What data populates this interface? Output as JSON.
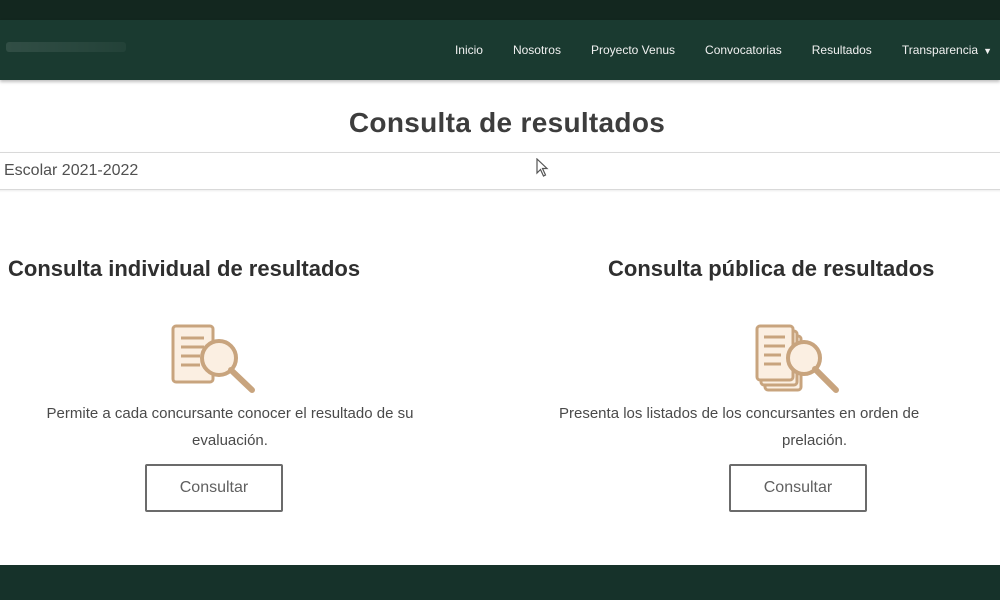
{
  "navbar": {
    "links": [
      "Inicio",
      "Nosotros",
      "Proyecto Venus",
      "Convocatorias",
      "Resultados",
      "Transparencia"
    ]
  },
  "page": {
    "title": "Consulta de resultados",
    "select_value": "Escolar 2021-2022"
  },
  "cards": {
    "individual": {
      "title": "Consulta individual de resultados",
      "desc_line1": "Permite a cada concursante conocer el resultado de su",
      "desc_line2": "evaluación.",
      "button": "Consultar",
      "icon": "document-search-icon"
    },
    "publica": {
      "title": "Consulta pública de resultados",
      "desc_line1": "Presenta los listados de los concursantes en orden de",
      "desc_line2": "prelación.",
      "button": "Consultar",
      "icon": "documents-search-icon"
    }
  },
  "colors": {
    "navbar": "#1a3a30",
    "accent_icon": "#c8a47e",
    "text": "#3d3d3d"
  }
}
